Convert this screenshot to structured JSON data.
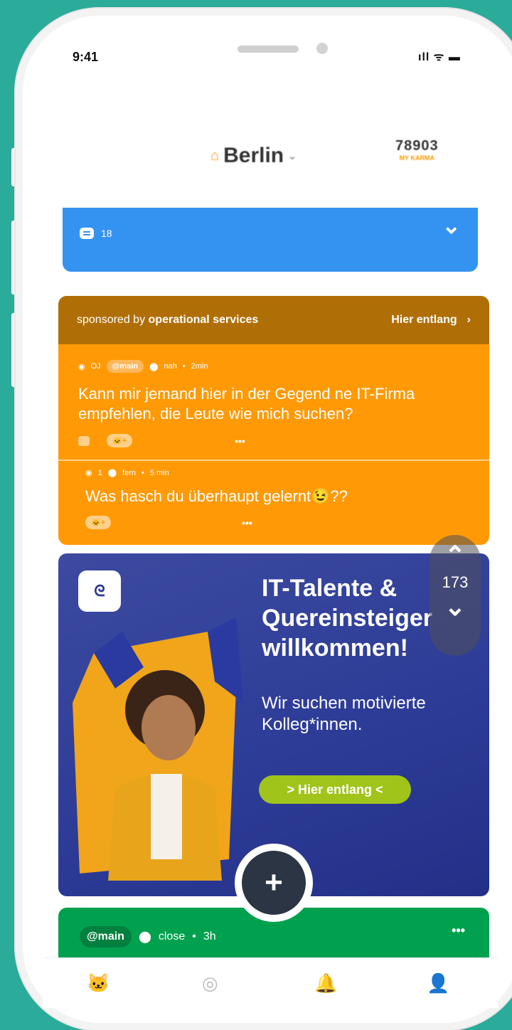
{
  "status": {
    "time": "9:41",
    "icons": "ıll ᯤ ▬"
  },
  "header": {
    "city": "Berlin",
    "karma_value": "78903",
    "karma_label": "MY KARMA"
  },
  "blue_card": {
    "comment_count": "18"
  },
  "sponsored": {
    "prefix": "sponsored by",
    "brand": "operational services",
    "link": "Hier entlang",
    "post": {
      "user": "OJ",
      "channel": "@main",
      "distance": "nah",
      "time": "2min",
      "text": "Kann mir jemand hier in der Gegend ne IT-Firma empfehlen, die Leute wie mich suchen?"
    },
    "reply": {
      "number": "1",
      "distance": "fern",
      "time": "5 min",
      "text": "Was hasch du überhaupt gelernt😉??"
    }
  },
  "ad": {
    "headline_1": "IT-Talente &",
    "headline_2": "Quereinsteiger",
    "headline_3": "willkommen!",
    "subline_1": "Wir suchen motivierte",
    "subline_2": "Kolleg*innen.",
    "button": "> Hier entlang <"
  },
  "vote": {
    "count": "173"
  },
  "green_card": {
    "channel": "@main",
    "distance": "close",
    "time": "3h"
  },
  "colors": {
    "orange": "#ff9a06",
    "blue": "#3493f0",
    "green": "#00a14e",
    "ad_blue": "#2c3b96",
    "cta": "#a0c41a"
  }
}
